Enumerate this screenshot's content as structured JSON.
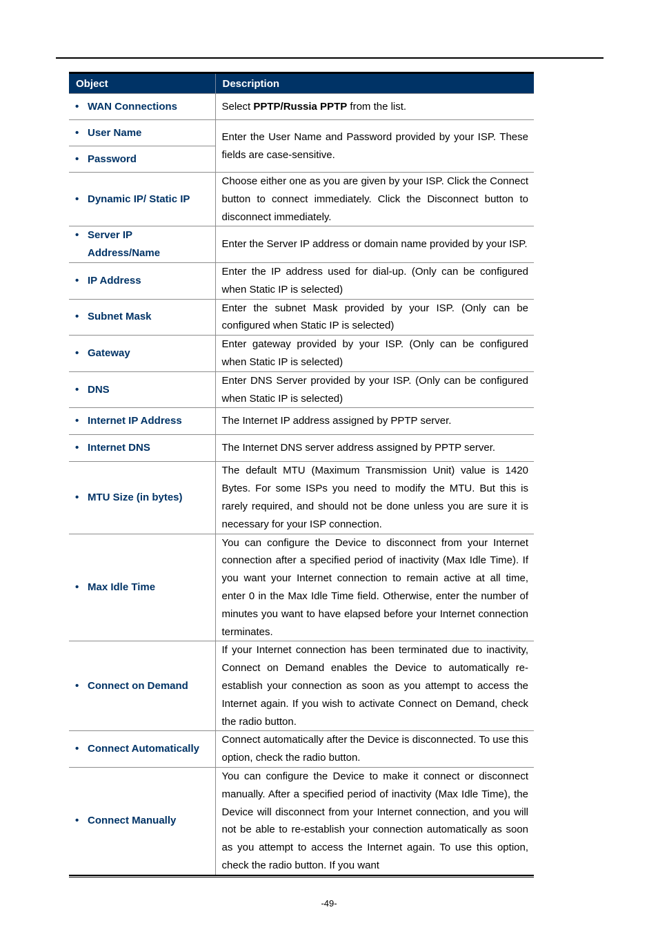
{
  "table": {
    "headers": {
      "object": "Object",
      "description": "Description"
    },
    "header_bg": "#003366",
    "object_color": "#003366",
    "rows": [
      {
        "object": "WAN Connections",
        "desc_pre": "Select ",
        "desc_bold": "PPTP/Russia PPTP",
        "desc_post": " from the list.",
        "h": 38
      },
      {
        "object": "User Name",
        "h": 38,
        "merged_desc": "Enter the User Name and Password provided by your ISP. These fields are case-sensitive.",
        "rowspan": 2
      },
      {
        "object": "Password",
        "h": 38
      },
      {
        "object": "Dynamic IP/ Static IP",
        "desc": "Choose either one as you are given by your ISP. Click the Connect button to connect immediately. Click the Disconnect button to disconnect immediately.",
        "h": 77
      },
      {
        "object": "Server IP Address/Name",
        "desc": "Enter the Server IP address or domain name provided by your ISP.",
        "h": 52
      },
      {
        "object": "IP Address",
        "desc": "Enter the IP address used for dial-up. (Only can be configured when Static IP is selected)",
        "h": 52
      },
      {
        "object": "Subnet Mask",
        "desc": "Enter the subnet Mask provided by your ISP. (Only can be configured when Static IP is selected)",
        "h": 52
      },
      {
        "object": "Gateway",
        "desc": "Enter gateway provided by your ISP. (Only can be configured when Static IP is selected)",
        "h": 52
      },
      {
        "object": "DNS",
        "desc": "Enter DNS Server provided by your ISP. (Only can be configured when Static IP is selected)",
        "h": 52
      },
      {
        "object": "Internet IP Address",
        "desc": "The Internet IP address assigned by PPTP server.",
        "h": 39
      },
      {
        "object": "Internet DNS",
        "desc": "The Internet DNS server address assigned by PPTP server.",
        "h": 39
      },
      {
        "object": "MTU Size (in bytes)",
        "desc": "The default MTU (Maximum Transmission Unit) value is 1420 Bytes. For some ISPs you need to modify the MTU. But this is rarely required, and should not be done unless you are sure it is necessary for your ISP connection.",
        "h": 103
      },
      {
        "object": "Max Idle Time",
        "desc": "You can configure the Device to disconnect from your Internet connection after a specified period of inactivity (Max Idle Time). If you want your Internet connection to remain active at all time, enter 0 in the Max Idle Time field. Otherwise, enter the number of minutes you want to have elapsed before your Internet connection terminates.",
        "h": 155
      },
      {
        "object": "Connect on Demand",
        "desc": "If your Internet connection has been terminated due to inactivity, Connect on Demand enables the Device to automatically re-establish your connection as soon as you attempt to access the Internet again. If you wish to activate Connect on Demand, check the radio button.",
        "h": 129
      },
      {
        "object": "Connect Automatically",
        "desc": "Connect automatically after the Device is disconnected. To use this option, check the radio button.",
        "h": 52
      },
      {
        "object": "Connect Manually",
        "desc": "You can configure the Device to make it connect or disconnect manually. After a specified period of inactivity (Max Idle Time), the Device will disconnect from your Internet connection, and you will not be able to re-establish your connection automatically as soon as you attempt to access the Internet again. To use this option, check the radio button. If you want",
        "h": 155
      }
    ]
  },
  "footer": {
    "page_number": "-49-"
  }
}
